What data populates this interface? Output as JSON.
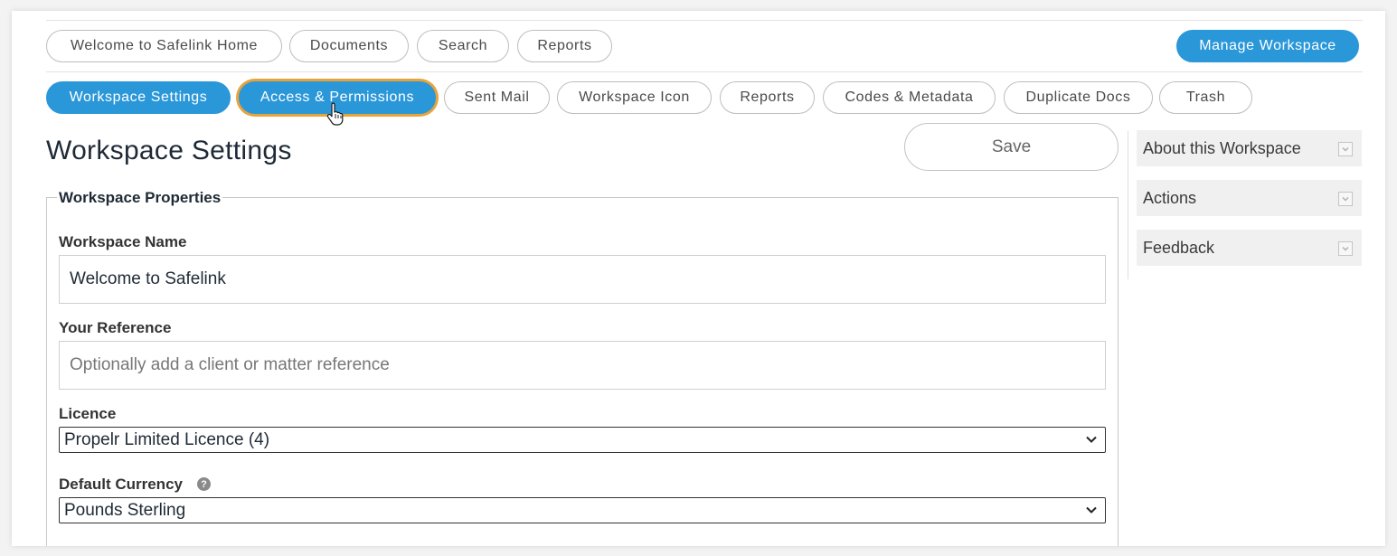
{
  "top_nav": {
    "items": [
      {
        "label": "Welcome to Safelink Home"
      },
      {
        "label": "Documents"
      },
      {
        "label": "Search"
      },
      {
        "label": "Reports"
      }
    ],
    "manage_label": "Manage Workspace"
  },
  "sub_nav": {
    "items": [
      {
        "label": "Workspace Settings",
        "state": "selected"
      },
      {
        "label": "Access & Permissions",
        "state": "hovered"
      },
      {
        "label": "Sent Mail"
      },
      {
        "label": "Workspace Icon"
      },
      {
        "label": "Reports"
      },
      {
        "label": "Codes & Metadata"
      },
      {
        "label": "Duplicate Docs"
      },
      {
        "label": "Trash"
      }
    ]
  },
  "page": {
    "title": "Workspace Settings",
    "save_label": "Save"
  },
  "form": {
    "legend": "Workspace Properties",
    "workspace_name": {
      "label": "Workspace Name",
      "value": "Welcome to Safelink"
    },
    "reference": {
      "label": "Your Reference",
      "value": "",
      "placeholder": "Optionally add a client or matter reference"
    },
    "licence": {
      "label": "Licence",
      "selected": "Propelr Limited Licence (4)"
    },
    "currency": {
      "label": "Default Currency",
      "selected": "Pounds Sterling",
      "help_icon": "question-circle-icon"
    }
  },
  "sidebar": {
    "panels": [
      {
        "label": "About this Workspace"
      },
      {
        "label": "Actions"
      },
      {
        "label": "Feedback"
      }
    ]
  },
  "colors": {
    "primary": "#2a97d9",
    "focus_ring": "#e8a33c",
    "panel_bg": "#f0f0f0"
  }
}
